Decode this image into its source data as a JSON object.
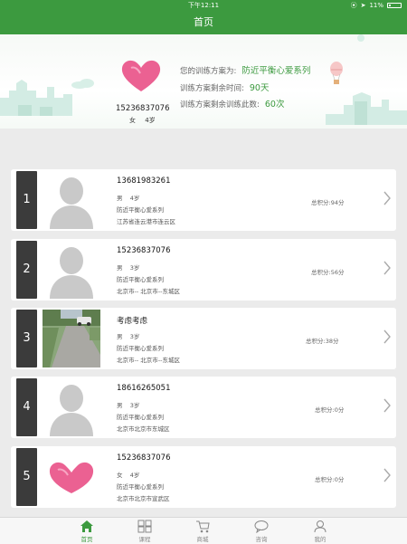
{
  "status_bar": {
    "time": "下午12:11",
    "battery": "11%"
  },
  "nav": {
    "title": "首页"
  },
  "profile": {
    "phone": "15236837076",
    "gender": "女",
    "age": "4岁",
    "plan_label": "您的训练方案为:",
    "plan_value": "防近平衡心爱系列",
    "time_label": "训练方案剩余时间:",
    "time_value": "90天",
    "count_label": "训练方案剩余训练此数:",
    "count_value": "60次"
  },
  "users": [
    {
      "index": "1",
      "name": "13681983261",
      "gender": "男",
      "age": "4岁",
      "plan": "防近平衡心爱系列",
      "address": "江苏省连云港市连云区",
      "score": "总积分:94分",
      "avatar": "silhouette-icon"
    },
    {
      "index": "2",
      "name": "15236837076",
      "gender": "男",
      "age": "3岁",
      "plan": "防近平衡心爱系列",
      "address": "北京市-- 北京市--东城区",
      "score": "总积分:56分",
      "avatar": "silhouette-icon"
    },
    {
      "index": "3",
      "name": "考虑考虑",
      "gender": "男",
      "age": "3岁",
      "plan": "防近平衡心爱系列",
      "address": "北京市-- 北京市--东城区",
      "score": "总积分:38分",
      "avatar": "street-photo"
    },
    {
      "index": "4",
      "name": "18616265051",
      "gender": "男",
      "age": "3岁",
      "plan": "防近平衡心爱系列",
      "address": "北京市北京市东城区",
      "score": "总积分:0分",
      "avatar": "silhouette-icon"
    },
    {
      "index": "5",
      "name": "15236837076",
      "gender": "女",
      "age": "4岁",
      "plan": "防近平衡心爱系列",
      "address": "北京市北京市宣武区",
      "score": "总积分:0分",
      "avatar": "heart-icon"
    }
  ],
  "tabs": [
    {
      "label": "首页",
      "icon": "home-icon",
      "active": true
    },
    {
      "label": "课程",
      "icon": "grid-icon",
      "active": false
    },
    {
      "label": "商城",
      "icon": "cart-icon",
      "active": false
    },
    {
      "label": "咨询",
      "icon": "chat-icon",
      "active": false
    },
    {
      "label": "我的",
      "icon": "user-icon",
      "active": false
    }
  ],
  "colors": {
    "accent": "#3c9a3f",
    "heart": "#e8457f",
    "index_bg": "#3b3b3b"
  }
}
